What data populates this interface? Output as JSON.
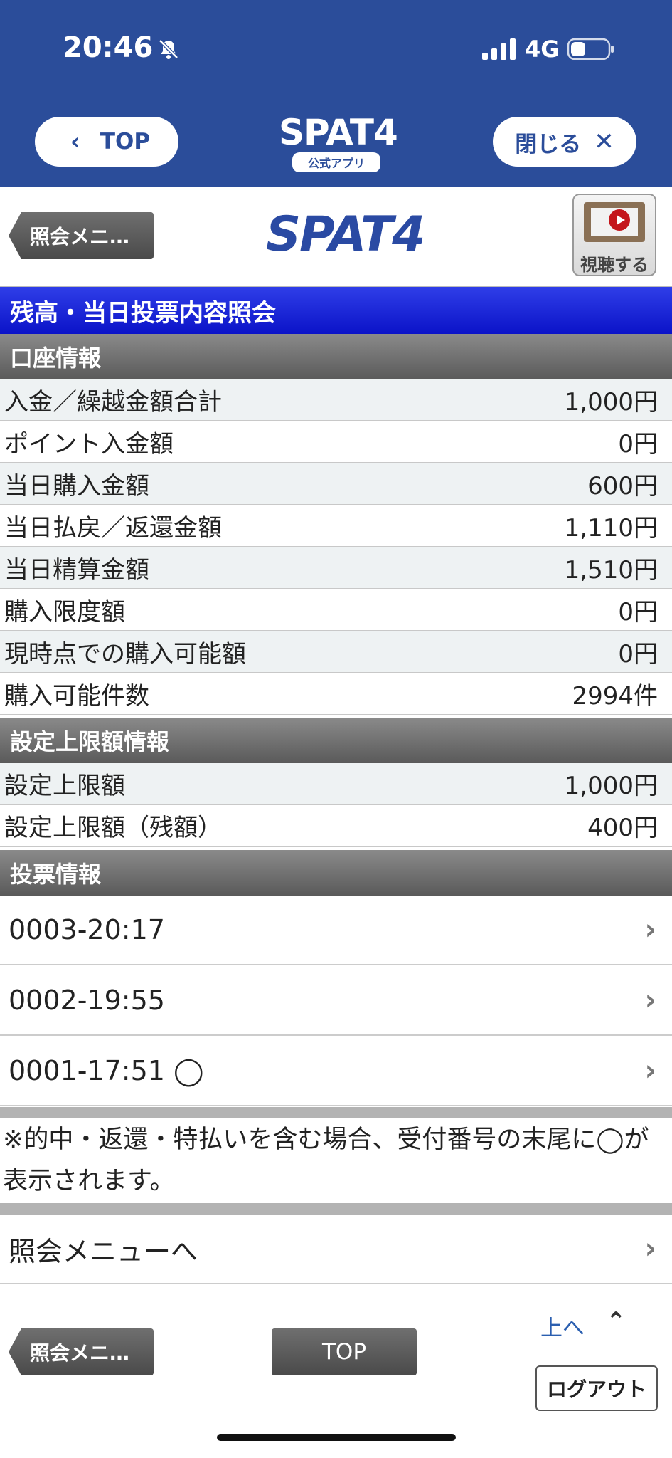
{
  "status_bar": {
    "time": "20:46",
    "network": "4G"
  },
  "app_header": {
    "top_label": "TOP",
    "logo_text": "SPAT4",
    "logo_sub": "公式アプリ",
    "close_label": "閉じる"
  },
  "subbar": {
    "back_label": "照会メニ…",
    "logo_text": "SPAT4",
    "watch_label": "視聴する"
  },
  "page_title": "残高・当日投票内容照会",
  "account": {
    "header": "口座情報",
    "rows": [
      {
        "label": "入金／繰越金額合計",
        "value": "1,000円"
      },
      {
        "label": "ポイント入金額",
        "value": "0円"
      },
      {
        "label": "当日購入金額",
        "value": "600円"
      },
      {
        "label": "当日払戻／返還金額",
        "value": "1,110円"
      },
      {
        "label": "当日精算金額",
        "value": "1,510円"
      },
      {
        "label": "購入限度額",
        "value": "0円"
      },
      {
        "label": "現時点での購入可能額",
        "value": "0円"
      },
      {
        "label": "購入可能件数",
        "value": "2994件"
      }
    ]
  },
  "limit": {
    "header": "設定上限額情報",
    "rows": [
      {
        "label": "設定上限額",
        "value": "1,000円"
      },
      {
        "label": "設定上限額（残額）",
        "value": "400円"
      }
    ]
  },
  "votes": {
    "header": "投票情報",
    "items": [
      "0003-20:17",
      "0002-19:55",
      "0001-17:51 ◯"
    ]
  },
  "note": "※的中・返還・特払いを含む場合、受付番号の末尾に◯が表示されます。",
  "menu_link": "照会メニューへ",
  "footer": {
    "back_label": "照会メニ…",
    "top_label": "TOP",
    "up_label": "上へ",
    "logout_label": "ログアウト"
  }
}
